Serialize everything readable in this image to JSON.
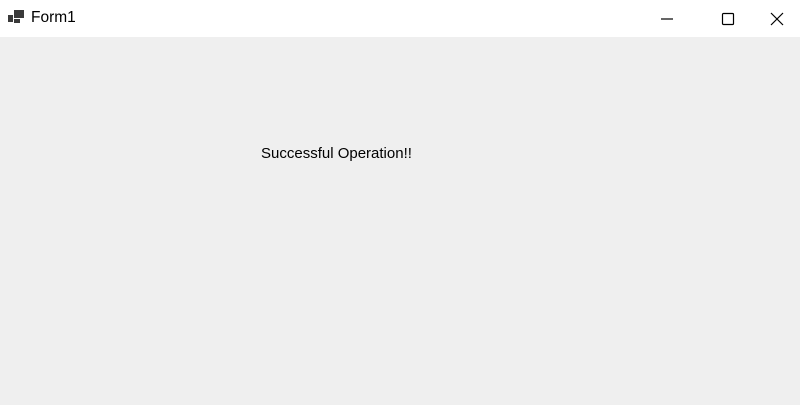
{
  "window": {
    "title": "Form1",
    "icon": "winforms-app-icon",
    "controls": {
      "minimize_icon": "minimize-icon",
      "maximize_icon": "maximize-icon",
      "close_icon": "close-icon"
    }
  },
  "form": {
    "message": "Successful Operation!!"
  },
  "colors": {
    "titlebar_bg": "#ffffff",
    "client_bg": "#efefef",
    "text": "#000000"
  }
}
